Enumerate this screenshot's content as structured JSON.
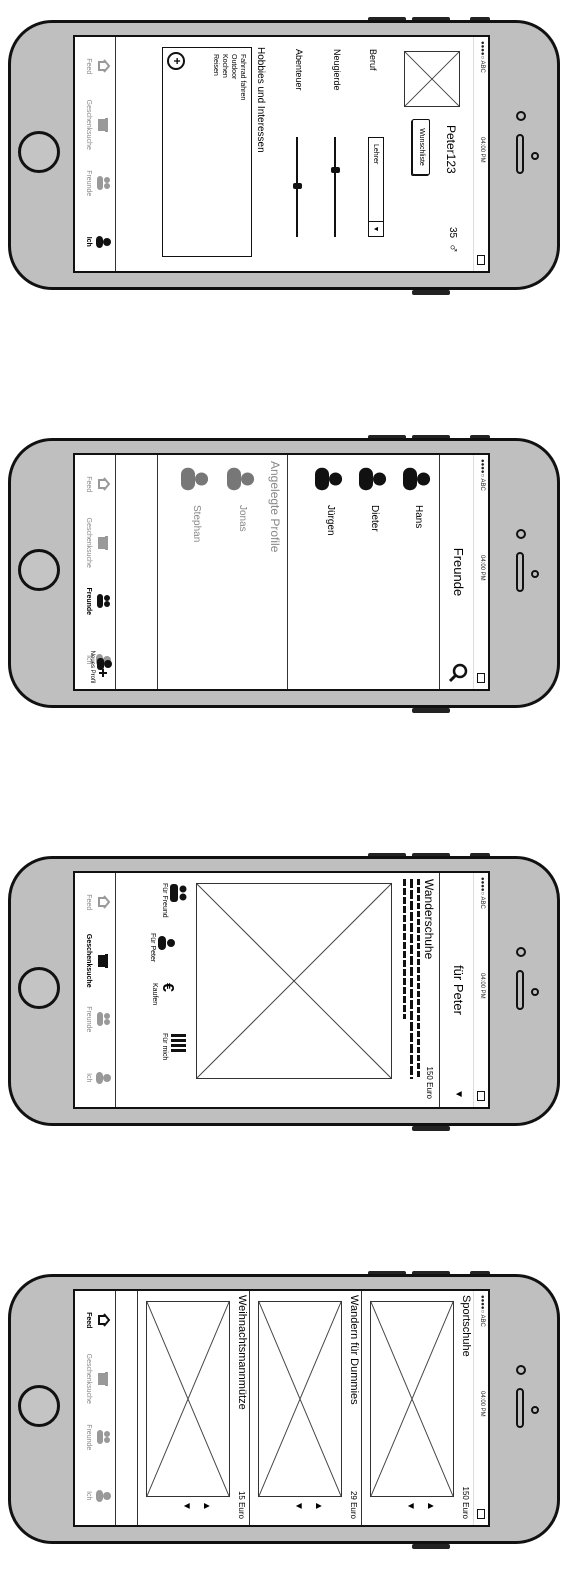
{
  "statusbar": {
    "carrier": "●●●●○ ABC",
    "time": "04:00 PM"
  },
  "tabs": [
    "Feed",
    "Geschenksuche",
    "Freunde",
    "Ich"
  ],
  "screen1": {
    "items": [
      {
        "title": "Sportschuhe",
        "price": "150 Euro"
      },
      {
        "title": "Wandern für Dummies",
        "price": "29 Euro"
      },
      {
        "title": "Weihnachtsmannmütze",
        "price": "15 Euro"
      }
    ]
  },
  "screen2": {
    "dropdown": "für Peter",
    "product": "Wanderschuhe",
    "price": "150 Euro",
    "actions": [
      "Für Freund",
      "Für Peter",
      "Kaufen",
      "Für mich"
    ]
  },
  "screen3": {
    "title": "Freunde",
    "friends": [
      "Hans",
      "Dieter",
      "Jürgen"
    ],
    "section": "Angelegte Profile",
    "profiles": [
      "Jonas",
      "Stephan"
    ],
    "new_profile": "Neues Profil"
  },
  "screen4": {
    "username": "Peter123",
    "age": "35",
    "gender_symbol": "♂",
    "wishlist": "Wunschliste",
    "beruf_label": "Beruf",
    "beruf_value": "Lehrer",
    "neugierde_label": "Neugierde",
    "abenteuer_label": "Abenteuer",
    "hobbies_label": "Hobbies und Interessen",
    "hobbies": [
      "Fahrrad fahren",
      "Outdoor",
      "Kochen",
      "Reisen"
    ]
  }
}
